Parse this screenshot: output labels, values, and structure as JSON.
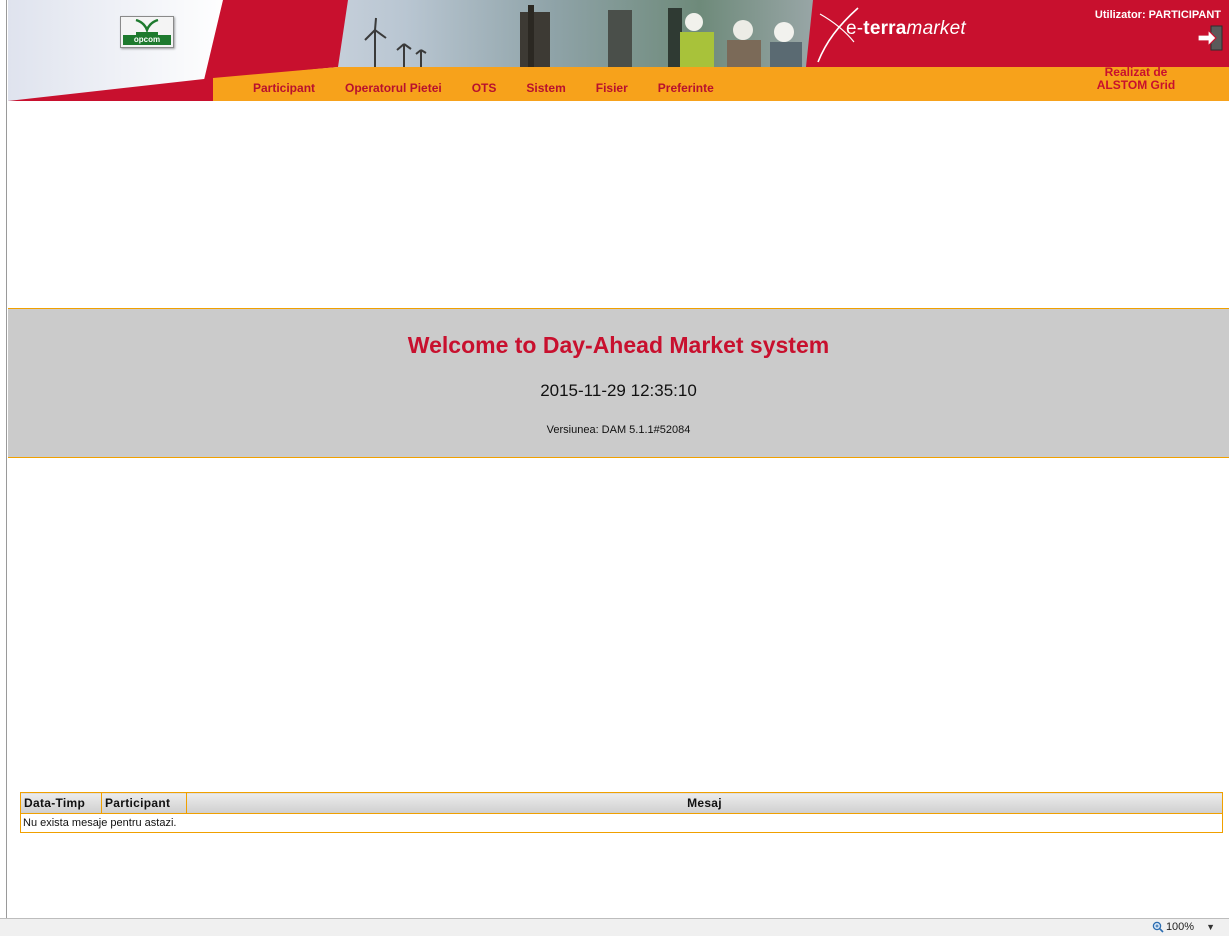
{
  "header": {
    "logo_text": "opcom",
    "brand_prefix": "e-",
    "brand_bold": "terra",
    "brand_italic": "market",
    "user_label": "Utilizator: PARTICIPANT",
    "credit_line1": "Realizat de",
    "credit_line2": "ALSTOM Grid",
    "logout_icon": "logout-arrow-icon",
    "colors": {
      "red": "#c8102e",
      "orange": "#f7a21b",
      "menu_text": "#b8102e"
    }
  },
  "menu": [
    "Participant",
    "Operatorul Pietei",
    "OTS",
    "Sistem",
    "Fisier",
    "Preferinte"
  ],
  "welcome": {
    "title": "Welcome to Day-Ahead Market system",
    "datetime": "2015-11-29 12:35:10",
    "version": "Versiunea: DAM 5.1.1#52084"
  },
  "messages": {
    "columns": [
      "Data-Timp",
      "Participant",
      "Mesaj"
    ],
    "empty_text": "Nu exista mesaje pentru astazi."
  },
  "statusbar": {
    "zoom": "100%"
  }
}
